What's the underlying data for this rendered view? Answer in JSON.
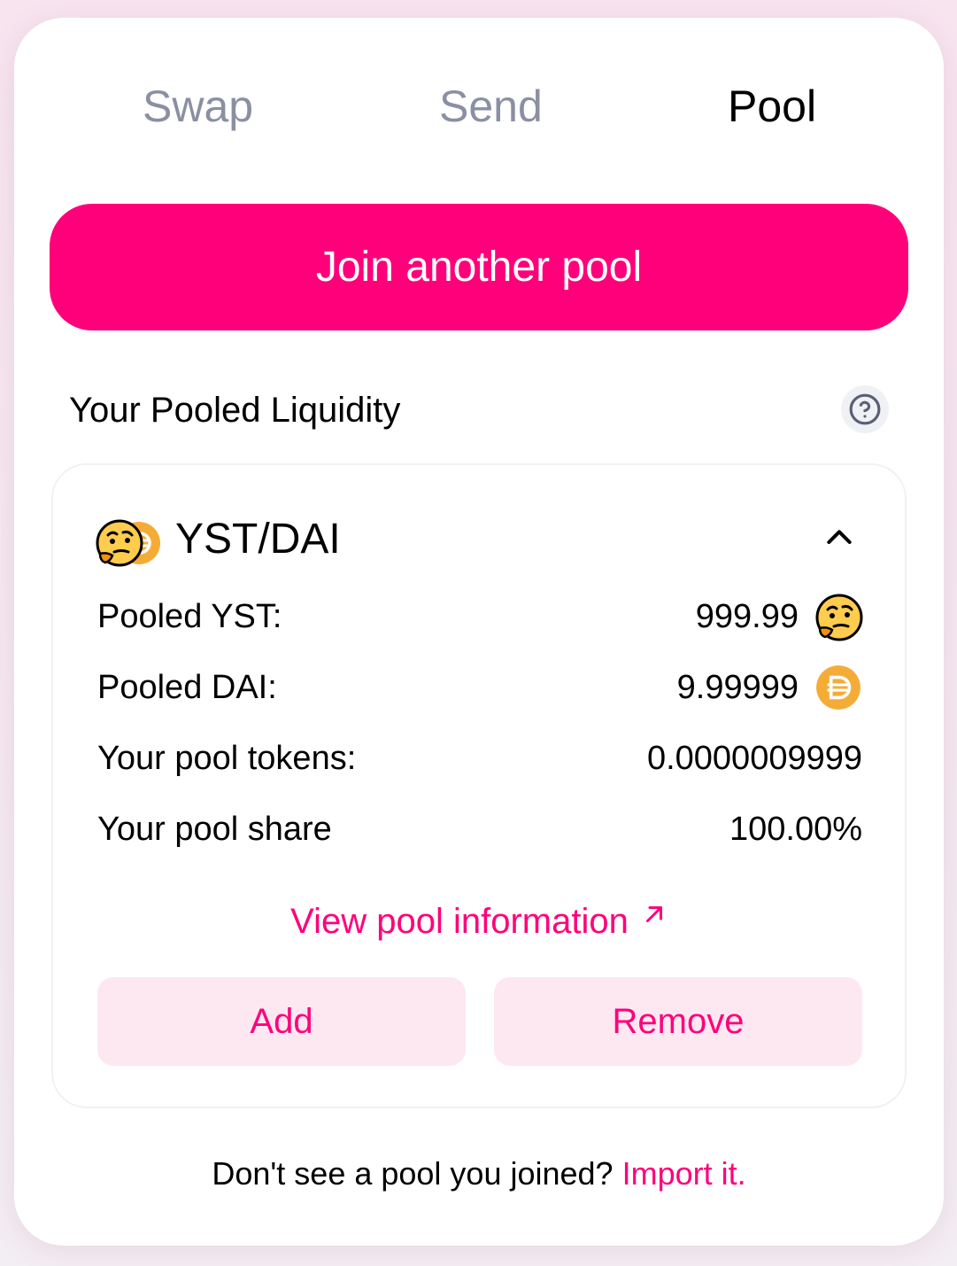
{
  "tabs": [
    {
      "label": "Swap",
      "active": false
    },
    {
      "label": "Send",
      "active": false
    },
    {
      "label": "Pool",
      "active": true
    }
  ],
  "join_button": {
    "label": "Join another pool"
  },
  "liquidity_section": {
    "title": "Your Pooled Liquidity",
    "help_icon": "question-circle-icon"
  },
  "pool": {
    "pair": "YST/DAI",
    "token_icons": [
      "thinking-face-icon",
      "dai-coin-icon"
    ],
    "expanded": true,
    "rows": [
      {
        "label": "Pooled YST:",
        "value": "999.99",
        "icon": "thinking-face-icon"
      },
      {
        "label": "Pooled DAI:",
        "value": "9.99999",
        "icon": "dai-coin-icon"
      },
      {
        "label": "Your pool tokens:",
        "value": "0.0000009999"
      },
      {
        "label": "Your pool share",
        "value": "100.00%"
      }
    ],
    "view_link": {
      "label": "View pool information",
      "icon": "external-arrow-icon"
    },
    "add_label": "Add",
    "remove_label": "Remove"
  },
  "footer": {
    "text": "Don't see a pool you joined?",
    "link": "Import it."
  },
  "colors": {
    "accent": "#ff007a",
    "pill_bg": "#fde8f1",
    "inactive_tab": "#8a8fa3",
    "dai_gold": "#f5ac37"
  }
}
